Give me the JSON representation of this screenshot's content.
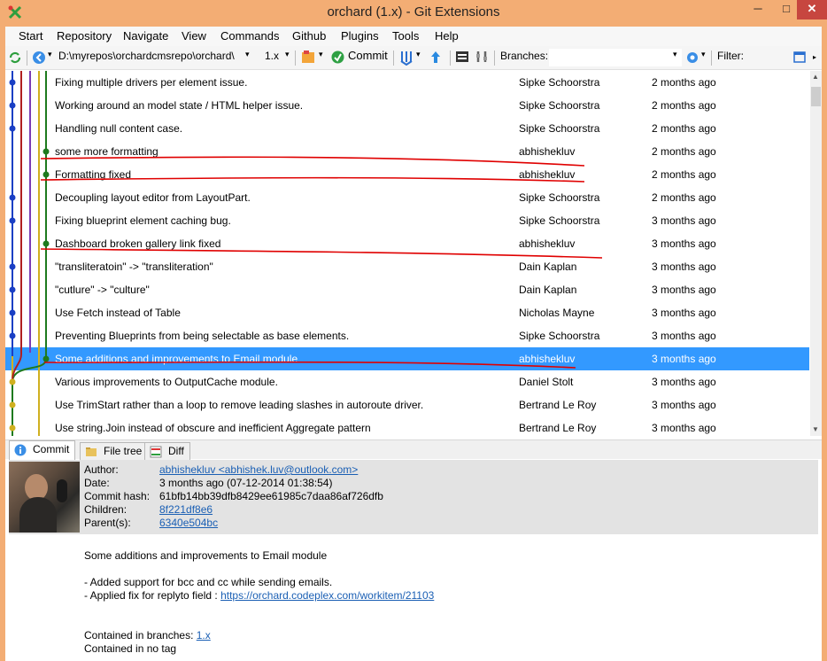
{
  "window": {
    "title": "orchard (1.x) - Git Extensions",
    "minimize": "─",
    "maximize": "□",
    "close": "✕"
  },
  "menu": [
    "Start",
    "Repository",
    "Navigate",
    "View",
    "Commands",
    "Github",
    "Plugins",
    "Tools",
    "Help"
  ],
  "toolbar": {
    "path": "D:\\myrepos\\orchardcmsrepo\\orchard\\",
    "branch": "1.x",
    "commit_label": "Commit",
    "branches_label": "Branches:",
    "filter_label": "Filter:"
  },
  "commits": [
    {
      "message": "Fixing multiple drivers per element issue.",
      "author": "Sipke Schoorstra",
      "date": "2 months ago"
    },
    {
      "message": "Working around an model state / HTML helper issue.",
      "author": "Sipke Schoorstra",
      "date": "2 months ago"
    },
    {
      "message": "Handling null content case.",
      "author": "Sipke Schoorstra",
      "date": "2 months ago"
    },
    {
      "message": "some more formatting",
      "author": "abhishekluv",
      "date": "2 months ago"
    },
    {
      "message": "Formatting fixed",
      "author": "abhishekluv",
      "date": "2 months ago"
    },
    {
      "message": "Decoupling layout editor from LayoutPart.",
      "author": "Sipke Schoorstra",
      "date": "2 months ago"
    },
    {
      "message": "Fixing blueprint element caching bug.",
      "author": "Sipke Schoorstra",
      "date": "3 months ago"
    },
    {
      "message": "Dashboard broken gallery link fixed",
      "author": "abhishekluv",
      "date": "3 months ago"
    },
    {
      "message": "\"transliteratoin\" -> \"transliteration\"",
      "author": "Dain Kaplan",
      "date": "3 months ago"
    },
    {
      "message": "\"cutlure\" -> \"culture\"",
      "author": "Dain Kaplan",
      "date": "3 months ago"
    },
    {
      "message": "Use Fetch instead of Table",
      "author": "Nicholas Mayne",
      "date": "3 months ago"
    },
    {
      "message": "Preventing Blueprints from being selectable as base elements.",
      "author": "Sipke Schoorstra",
      "date": "3 months ago"
    },
    {
      "message": "Some additions and improvements to Email module",
      "author": "abhishekluv",
      "date": "3 months ago"
    },
    {
      "message": "Various improvements to OutputCache module.",
      "author": "Daniel Stolt",
      "date": "3 months ago"
    },
    {
      "message": "Use TrimStart rather than a loop to remove leading slashes in autoroute driver.",
      "author": "Bertrand Le Roy",
      "date": "3 months ago"
    },
    {
      "message": "Use string.Join instead of obscure and inefficient Aggregate pattern",
      "author": "Bertrand Le Roy",
      "date": "3 months ago"
    }
  ],
  "tabs": {
    "commit": "Commit",
    "file_tree": "File tree",
    "diff": "Diff"
  },
  "details": {
    "author_label": "Author:",
    "author_value": "abhishekluv <abhishek.luv@outlook.com>",
    "date_label": "Date:",
    "date_value": "3 months ago (07-12-2014 01:38:54)",
    "hash_label": "Commit hash:",
    "hash_value": "61bfb14bb39dfb8429ee61985c7daa86af726dfb",
    "children_label": "Children:",
    "children_value": "8f221df8e6",
    "parents_label": "Parent(s):",
    "parents_value": "6340e504bc"
  },
  "message": {
    "subject": "Some additions and improvements to Email module",
    "line1": "- Added support for bcc and cc while sending emails.",
    "line2_prefix": "- Applied fix for replyto field : ",
    "line2_link": "https://orchard.codeplex.com/workitem/21103",
    "branches_prefix": "Contained in branches: ",
    "branches_link": "1.x",
    "tags": "Contained in no tag"
  },
  "colors": {
    "titlebar": "#f3ad74",
    "selection": "#3399ff",
    "close": "#c7463f",
    "link": "#1a5fb4",
    "annotation": "#e00000"
  }
}
